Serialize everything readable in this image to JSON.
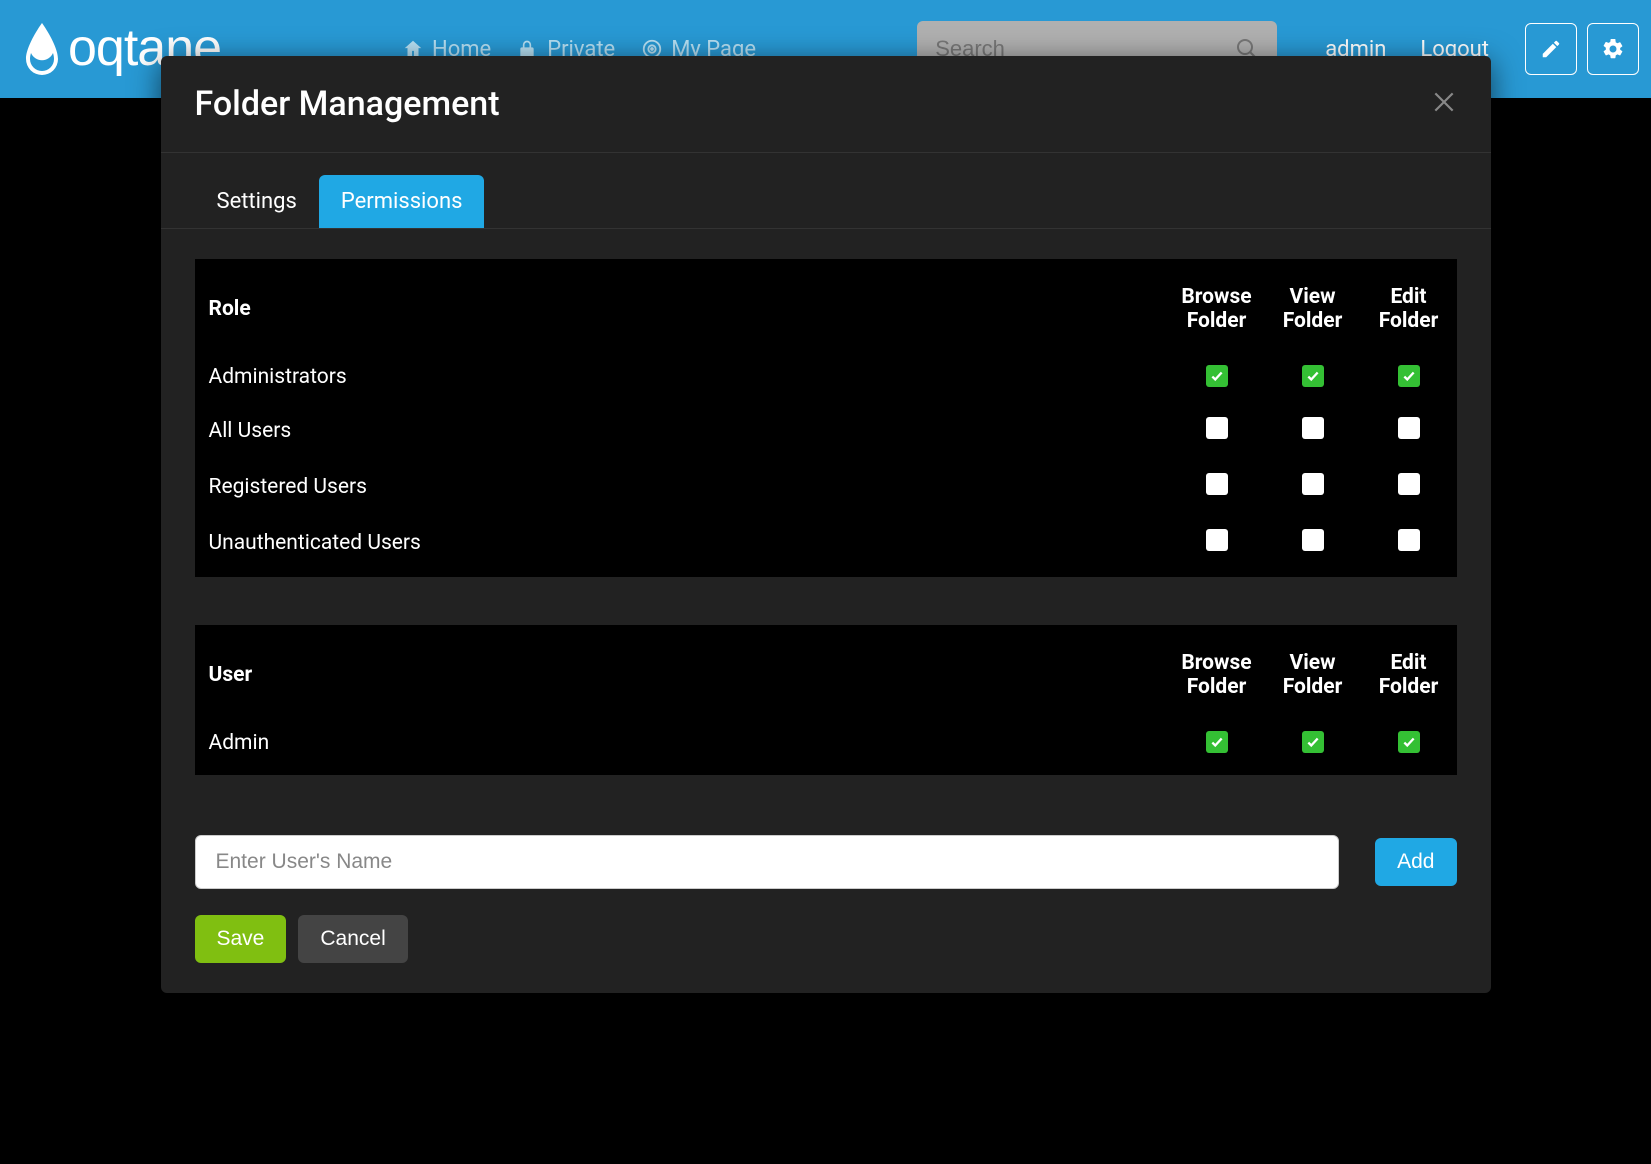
{
  "nav": {
    "links": [
      {
        "icon": "home",
        "label": "Home"
      },
      {
        "icon": "lock",
        "label": "Private"
      },
      {
        "icon": "target",
        "label": "My Page"
      }
    ],
    "search_placeholder": "Search",
    "user_label": "admin",
    "logout_label": "Logout"
  },
  "modal": {
    "title": "Folder Management",
    "tabs": {
      "settings": "Settings",
      "permissions": "Permissions",
      "active": "permissions"
    },
    "role_table": {
      "head": {
        "name": "Role",
        "browse": "Browse Folder",
        "view": "View Folder",
        "edit": "Edit Folder"
      },
      "rows": [
        {
          "name": "Administrators",
          "browse": true,
          "view": true,
          "edit": true
        },
        {
          "name": "All Users",
          "browse": false,
          "view": false,
          "edit": false
        },
        {
          "name": "Registered Users",
          "browse": false,
          "view": false,
          "edit": false
        },
        {
          "name": "Unauthenticated Users",
          "browse": false,
          "view": false,
          "edit": false
        }
      ]
    },
    "user_table": {
      "head": {
        "name": "User",
        "browse": "Browse Folder",
        "view": "View Folder",
        "edit": "Edit Folder"
      },
      "rows": [
        {
          "name": "Admin",
          "browse": true,
          "view": true,
          "edit": true
        }
      ]
    },
    "add_user": {
      "placeholder": "Enter User's Name",
      "button": "Add"
    },
    "footer": {
      "save": "Save",
      "cancel": "Cancel"
    }
  }
}
